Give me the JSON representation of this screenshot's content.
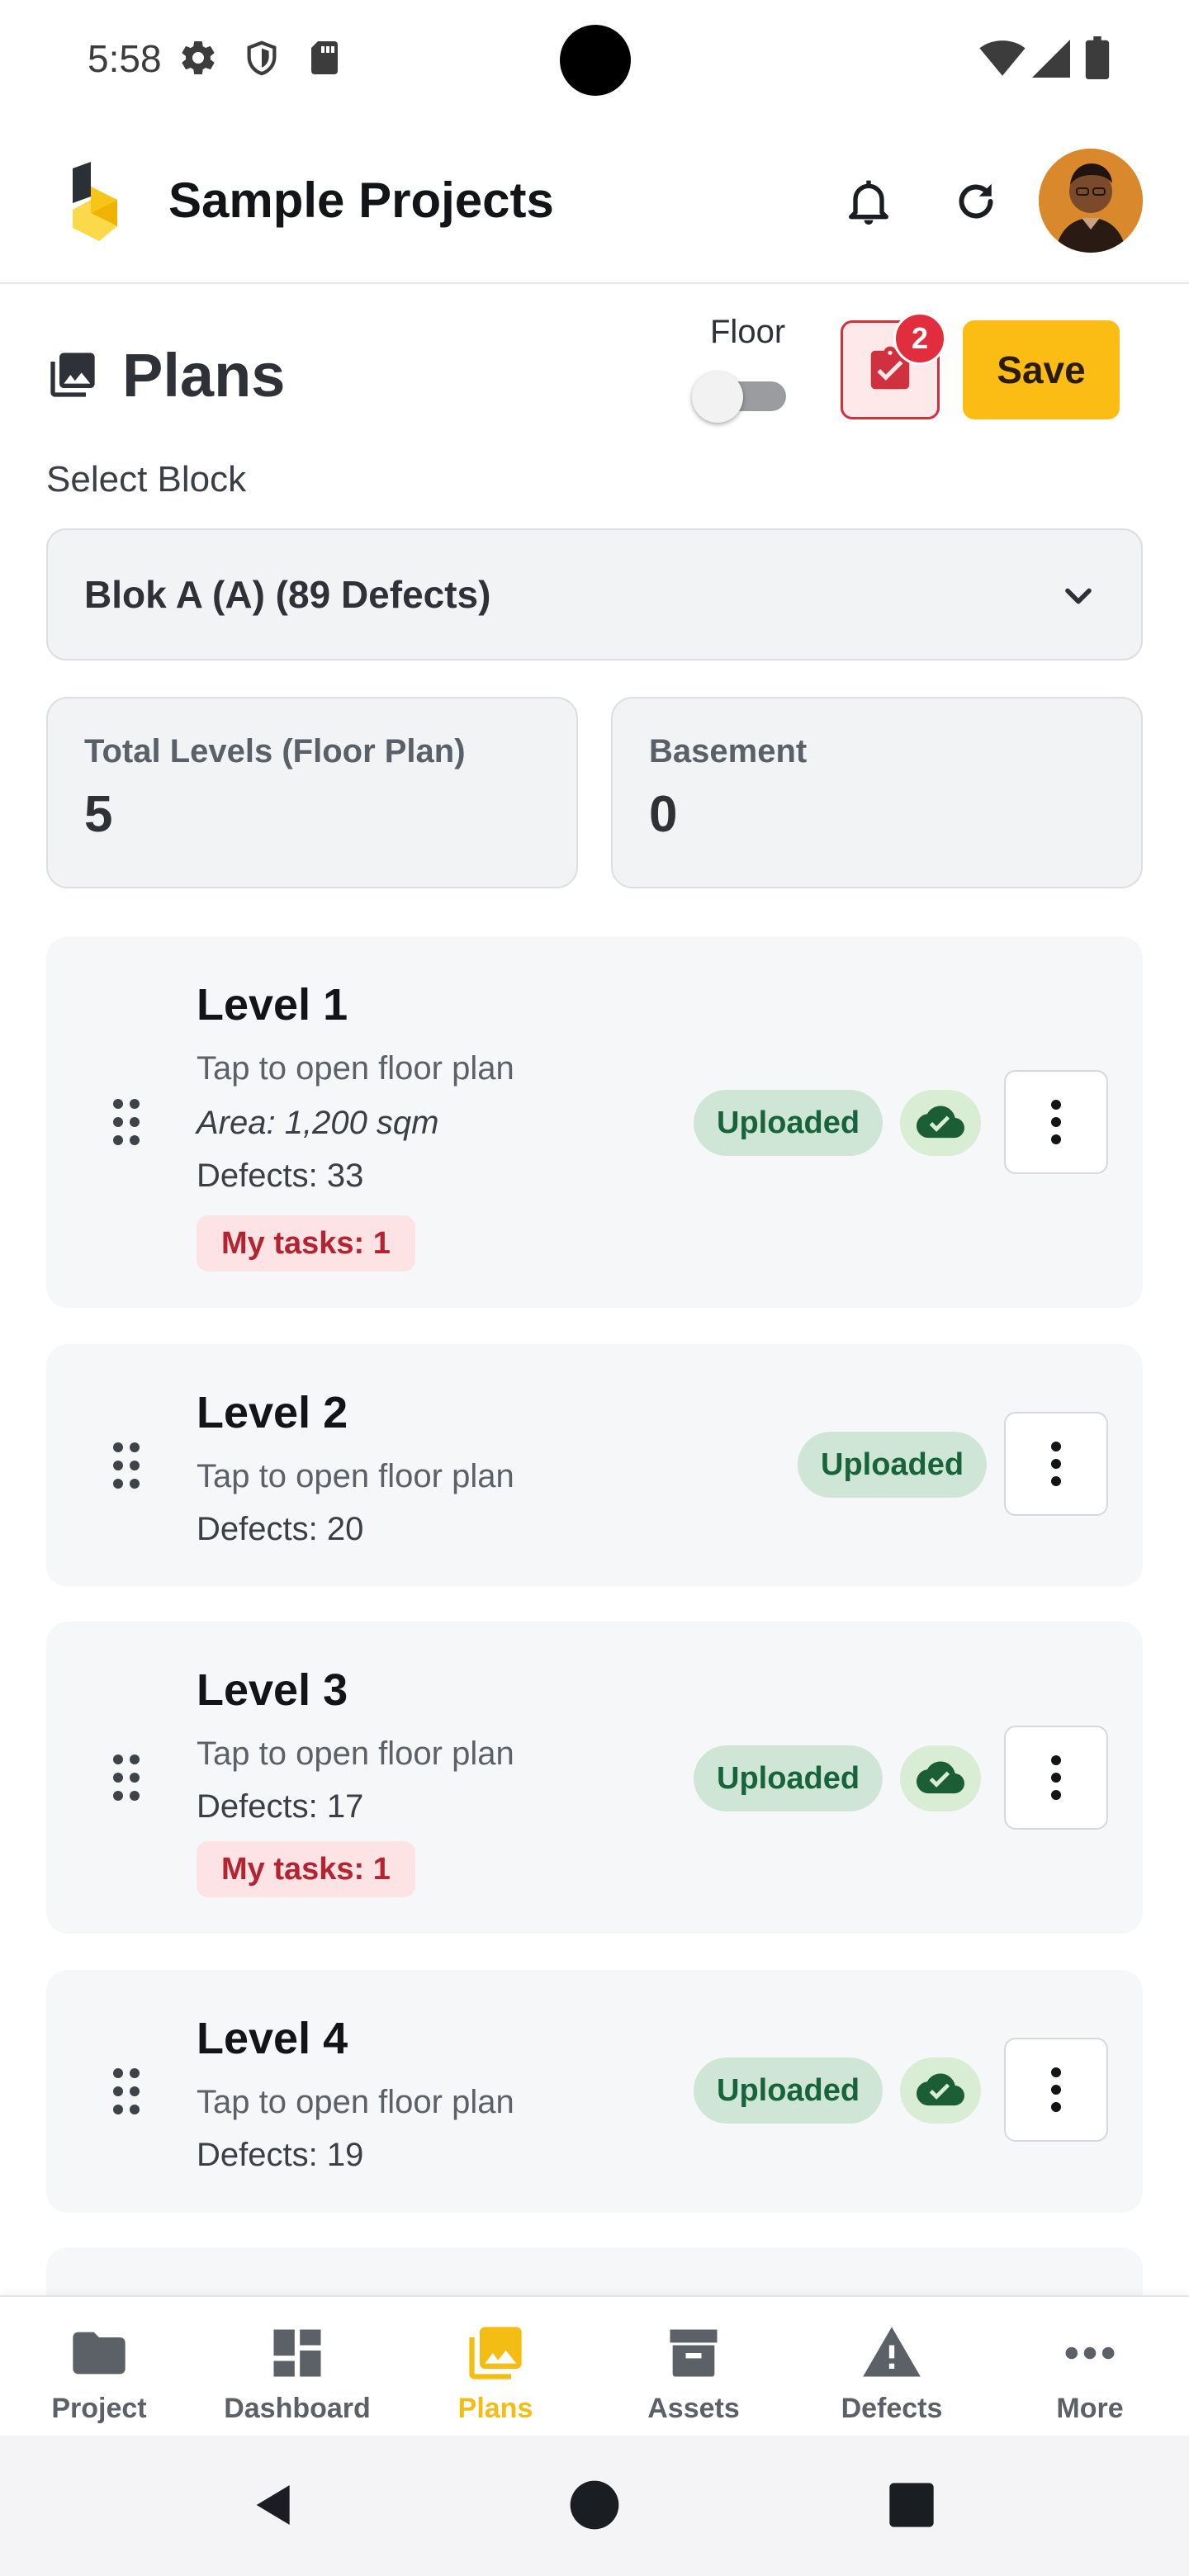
{
  "status_bar": {
    "time": "5:58"
  },
  "header": {
    "title": "Sample Projects"
  },
  "plans": {
    "title": "Plans",
    "floor_label": "Floor",
    "floor_toggle_on": false,
    "task_badge_count": "2",
    "save_label": "Save"
  },
  "block_select": {
    "label": "Select Block",
    "value": "Blok A (A) (89 Defects)"
  },
  "stats": [
    {
      "label": "Total Levels (Floor Plan)",
      "value": "5"
    },
    {
      "label": "Basement",
      "value": "0"
    }
  ],
  "levels": [
    {
      "title": "Level 1",
      "subtitle": "Tap to open floor plan",
      "area": "Area: 1,200 sqm",
      "defects": "Defects: 33",
      "my_tasks": "My tasks: 1",
      "status": "Uploaded",
      "synced": true
    },
    {
      "title": "Level 2",
      "subtitle": "Tap to open floor plan",
      "defects": "Defects: 20",
      "status": "Uploaded",
      "synced": false
    },
    {
      "title": "Level 3",
      "subtitle": "Tap to open floor plan",
      "defects": "Defects: 17",
      "my_tasks": "My tasks: 1",
      "status": "Uploaded",
      "synced": true
    },
    {
      "title": "Level 4",
      "subtitle": "Tap to open floor plan",
      "defects": "Defects: 19",
      "status": "Uploaded",
      "synced": true
    }
  ],
  "bottom_nav": [
    {
      "label": "Project",
      "icon": "folder-icon",
      "active": false
    },
    {
      "label": "Dashboard",
      "icon": "dashboard-icon",
      "active": false
    },
    {
      "label": "Plans",
      "icon": "photo-library-icon",
      "active": true
    },
    {
      "label": "Assets",
      "icon": "archive-box-icon",
      "active": false
    },
    {
      "label": "Defects",
      "icon": "warning-icon",
      "active": false
    },
    {
      "label": "More",
      "icon": "more-horizontal-icon",
      "active": false
    }
  ],
  "colors": {
    "accent": "#FBBD14",
    "danger": "#E22D3E",
    "success_bg": "#CFE6D7",
    "success_text": "#17643A"
  }
}
